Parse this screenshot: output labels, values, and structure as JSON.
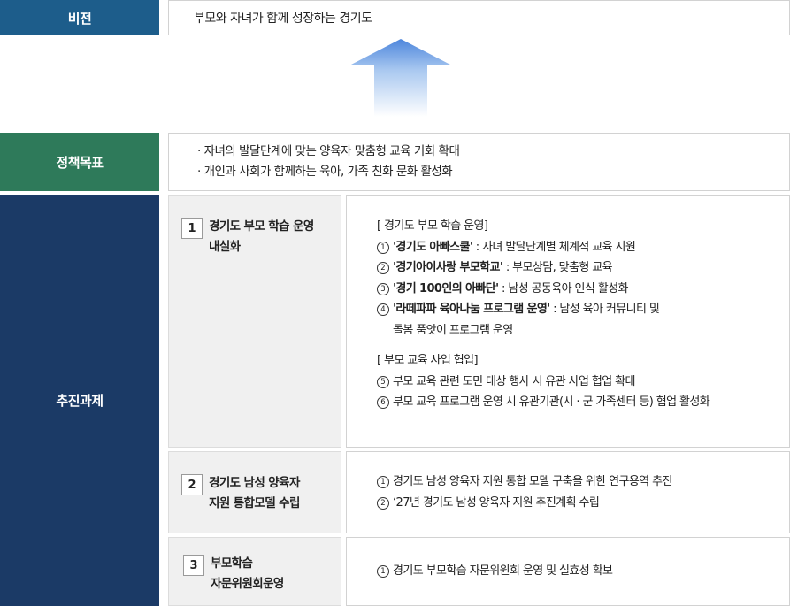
{
  "vision": {
    "label": "비전",
    "text": "부모와 자녀가 함께 성장하는 경기도"
  },
  "policy": {
    "label": "정책목표",
    "items": [
      "· 자녀의 발달단계에 맞는 양육자 맞춤형 교육 기회 확대",
      "· 개인과 사회가 함께하는 육아, 가족 친화 문화 활성화"
    ]
  },
  "tasks": {
    "label": "추진과제",
    "task1": {
      "num": "1",
      "title_line1": "경기도 부모 학습 운영",
      "title_line2": "내실화",
      "section1_header": "[ 경기도 부모 학습 운영]",
      "items": [
        {
          "marker": "1",
          "bold": "'경기도 아빠스쿨'",
          "rest": " : 자녀 발달단계별 체계적 교육 지원"
        },
        {
          "marker": "2",
          "bold": "'경기아이사랑 부모학교'",
          "rest": " : 부모상담, 맞춤형 교육"
        },
        {
          "marker": "3",
          "bold": "'경기 100인의 아빠단'",
          "rest": " : 남성 공동육아 인식 활성화"
        },
        {
          "marker": "4",
          "bold": "'라떼파파 육아나눔 프로그램 운영'",
          "rest": " : 남성 육아 커뮤니티 및"
        }
      ],
      "item4_cont": "돌봄 품앗이 프로그램 운영",
      "section2_header": "[ 부모 교육 사업 협업]",
      "items2": [
        {
          "marker": "5",
          "text": "부모 교육 관련 도민 대상 행사 시 유관 사업 협업 확대"
        },
        {
          "marker": "6",
          "text": "부모 교육 프로그램 운영 시 유관기관(시 · 군 가족센터 등) 협업 활성화"
        }
      ]
    },
    "task2": {
      "num": "2",
      "title_line1": "경기도 남성 양육자",
      "title_line2": "지원 통합모델 수립",
      "items": [
        {
          "marker": "1",
          "text": "경기도 남성 양육자 지원 통합 모델 구축을 위한 연구용역 추진"
        },
        {
          "marker": "2",
          "text": "‘27년 경기도 남성 양육자 지원 추진계획 수립"
        }
      ]
    },
    "task3": {
      "num": "3",
      "title_line1": "부모학습",
      "title_line2": "자문위원회운영",
      "items": [
        {
          "marker": "1",
          "text": "경기도 부모학습 자문위원회 운영 및 실효성 확보"
        }
      ]
    }
  },
  "colors": {
    "vision_label_bg": "#1d5d8b",
    "policy_label_bg": "#2e7a5a",
    "task_label_bg": "#1b3a66",
    "arrow_top": "#5a8fe0",
    "arrow_bottom": "#ffffff"
  },
  "icons": {
    "arrow": "up-arrow-gradient-icon"
  }
}
